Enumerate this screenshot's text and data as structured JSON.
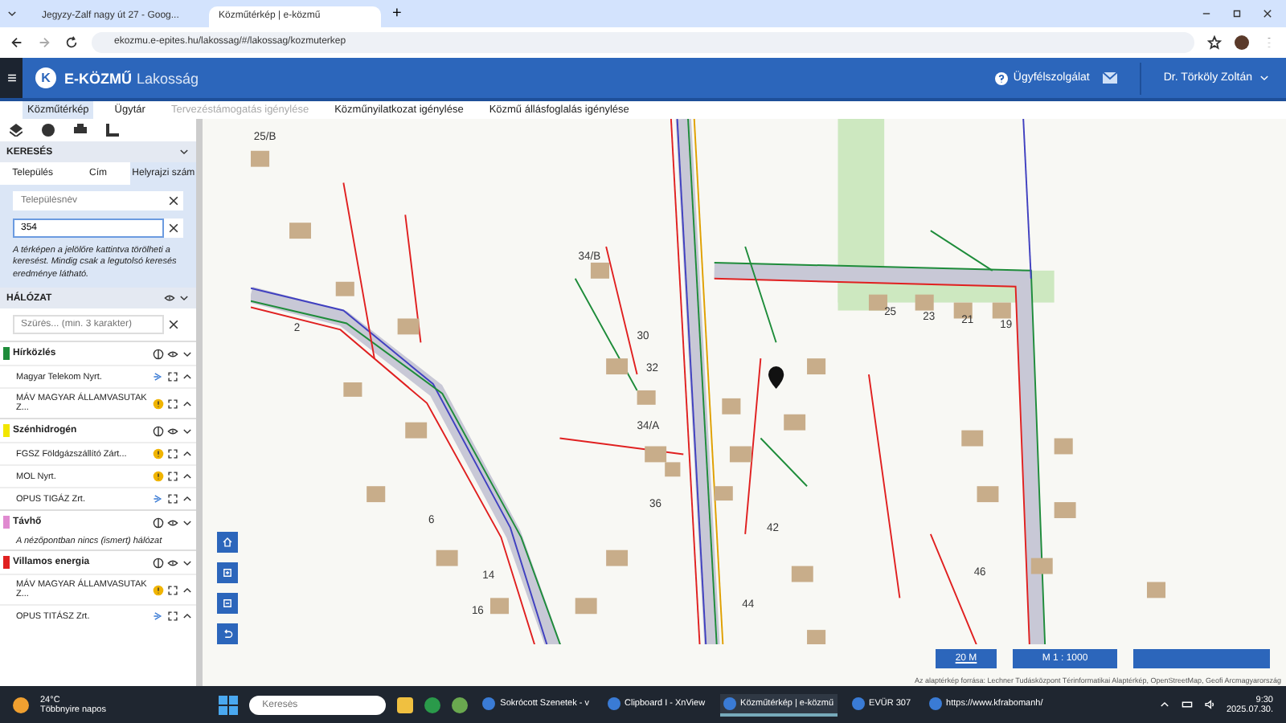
{
  "browser": {
    "tabs": [
      {
        "title": "Jegyzy-Zalf nagy út 27 - Goog...",
        "selected": false
      },
      {
        "title": "Közműtérkép | e-közmű",
        "selected": true
      }
    ],
    "new_tab": "+",
    "url": "ekozmu.e-epites.hu/lakossag/#/lakossag/kozmuterkep"
  },
  "header": {
    "logo": "K",
    "brand": "E-KÖZMŰ",
    "subtitle": "Lakosság",
    "help": "Ügyfélszolgálat",
    "user": "Dr. Törköly Zoltán"
  },
  "nav": [
    {
      "label": "Közműtérkép",
      "selected": true,
      "disabled": false
    },
    {
      "label": "Ügytár",
      "selected": false,
      "disabled": false
    },
    {
      "label": "Tervezéstámogatás igénylése",
      "selected": false,
      "disabled": true
    },
    {
      "label": "Közműnyilatkozat igénylése",
      "selected": false,
      "disabled": false
    },
    {
      "label": "Közmű állásfoglalás igénylése",
      "selected": false,
      "disabled": false
    }
  ],
  "sidebar": {
    "search": {
      "title": "KERESÉS",
      "tabs": [
        {
          "label": "Település",
          "selected": false
        },
        {
          "label": "Cím",
          "selected": false
        },
        {
          "label": "Helyrajzi szám",
          "selected": true
        }
      ],
      "fields": [
        {
          "placeholder": "Településnév"
        },
        {
          "value": "354"
        }
      ],
      "note": "A térképen a jelölőre kattintva törölheti a keresést. Mindig csak a legutolsó keresés eredménye látható."
    },
    "network": {
      "title": "HÁLÓZAT",
      "filter": {
        "placeholder": "Szűrés... (min. 3 karakter)"
      },
      "groups": [
        {
          "name": "Hírközlés",
          "color": "#1e8c3a",
          "operators": [
            {
              "name": "Magyar Telekom Nyrt.",
              "kind": "link"
            },
            {
              "name": "MÁV MAGYAR ÁLLAMVASUTAK Z...",
              "kind": "warning"
            }
          ]
        },
        {
          "name": "Szénhidrogén",
          "color": "#f2e600",
          "operators": [
            {
              "name": "FGSZ Földgázszállító Zárt...",
              "kind": "warning"
            },
            {
              "name": "MOL Nyrt.",
              "kind": "warning"
            },
            {
              "name": "OPUS TIGÁZ Zrt.",
              "kind": "link"
            }
          ]
        },
        {
          "name": "Távhő",
          "color": "#e08ad0",
          "note": "A nézőpontban nincs (ismert) hálózat"
        },
        {
          "name": "Villamos energia",
          "color": "#e02020",
          "operators": [
            {
              "name": "MÁV MAGYAR ÁLLAMVASUTAK Z...",
              "kind": "warning"
            },
            {
              "name": "OPUS TITÁSZ Zrt.",
              "kind": "link"
            }
          ]
        }
      ]
    }
  },
  "map": {
    "labels": [
      "25/B",
      "2",
      "34/B",
      "30",
      "32",
      "34/A",
      "25",
      "23",
      "21",
      "19",
      "36",
      "6",
      "16",
      "14",
      "42",
      "44",
      "46"
    ],
    "scale": "20 M",
    "ratio": "M   1 : 1000",
    "attribution": "Az alaptérkép forrása: Lechner Tudásközpont Térinformatikai Alaptérkép, OpenStreetMap, Geofi Arcmagyarország"
  },
  "taskbar": {
    "weather": {
      "temp": "24°C",
      "text": "Többnyire napos"
    },
    "search": {
      "placeholder": "Keresés"
    },
    "apps": [
      {
        "label": "Sokrócott Szenetek - v",
        "selected": false
      },
      {
        "label": "Clipboard I - XnView",
        "selected": false
      },
      {
        "label": "Közműtérkép | e-közmű",
        "selected": true
      },
      {
        "label": "EVÜR 307",
        "selected": false
      },
      {
        "label": "https://www.kfrabomanh/",
        "selected": false
      }
    ],
    "time": "9:30",
    "date": "2025.07.30."
  }
}
